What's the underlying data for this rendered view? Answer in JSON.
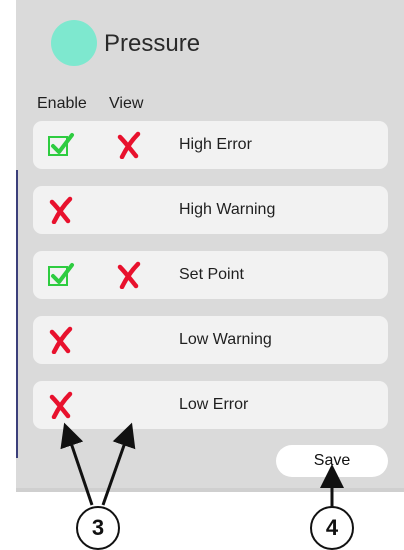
{
  "header": {
    "title": "Pressure",
    "status_color": "#7ee8cf"
  },
  "columns": {
    "enable": "Enable",
    "view": "View"
  },
  "rows": [
    {
      "label": "High Error",
      "enable_icon": "checkmark-icon",
      "view_icon": "cross-icon"
    },
    {
      "label": "High Warning",
      "enable_icon": "cross-icon",
      "view_icon": null
    },
    {
      "label": "Set Point",
      "enable_icon": "checkmark-icon",
      "view_icon": "cross-icon"
    },
    {
      "label": "Low Warning",
      "enable_icon": "cross-icon",
      "view_icon": null
    },
    {
      "label": "Low Error",
      "enable_icon": "cross-icon",
      "view_icon": null
    }
  ],
  "actions": {
    "save_label": "Save"
  },
  "callouts": {
    "first": "3",
    "second": "4"
  },
  "colors": {
    "check_green": "#2ecc40",
    "cross_red": "#e8112d",
    "panel_bg": "#dadada",
    "row_bg": "#f2f2f2"
  }
}
